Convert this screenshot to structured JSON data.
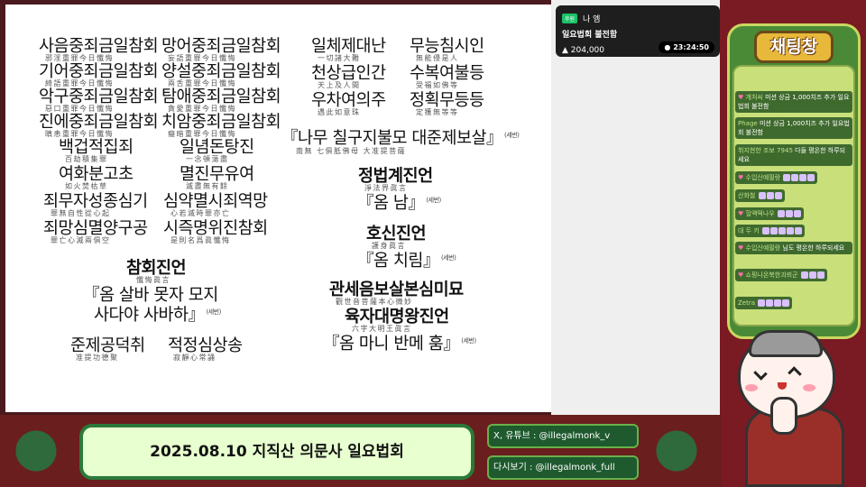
{
  "slide": {
    "left_column": [
      {
        "text": "사음중죄금일참회",
        "sub": "邪淫重罪今日懺悔"
      },
      {
        "text": "기어중죄금일참회",
        "sub": "綺語重罪今日懺悔"
      },
      {
        "text": "악구중죄금일참회",
        "sub": "惡口重罪今日懺悔"
      },
      {
        "text": "진에중죄금일참회",
        "sub": "瞋恚重罪今日懺悔"
      }
    ],
    "middle_column": [
      {
        "text": "망어중죄금일참회",
        "sub": "妄語重罪今日懺悔"
      },
      {
        "text": "양설중죄금일참회",
        "sub": "兩舌重罪今日懺悔"
      },
      {
        "text": "탐애중죄금일참회",
        "sub": "貪愛重罪今日懺悔"
      },
      {
        "text": "치암중죄금일참회",
        "sub": "癡暗重罪今日懺悔"
      }
    ],
    "verse_left": [
      {
        "text": "백겁적집죄",
        "sub": "百劫積集罪"
      },
      {
        "text": "일념돈탕진",
        "sub": "一念頓蕩盡"
      },
      {
        "text": "여화분고초",
        "sub": "如火焚枯草"
      },
      {
        "text": "멸진무유여",
        "sub": "滅盡無有餘"
      },
      {
        "text": "죄무자성종심기",
        "sub": "罪無自性從心起"
      },
      {
        "text": "심약멸시죄역망",
        "sub": "心若滅時罪亦亡"
      },
      {
        "text": "죄망심멸양구공",
        "sub": "罪亡心滅兩俱空"
      },
      {
        "text": "시즉명위진참회",
        "sub": "是則名爲眞懺悔"
      }
    ],
    "chamhoe_title": {
      "text": "참회진언",
      "sub": "懺悔眞言"
    },
    "chamhoe_mantra1": "『옴 살바 못자 모지",
    "chamhoe_mantra2": "사다야 사바하』",
    "tag": "(세번)",
    "junje_left": {
      "text": "준제공덕취",
      "sub": "准提功德聚"
    },
    "junje_right": {
      "text": "적정심상송",
      "sub": "寂靜心常誦"
    },
    "right_verse": [
      {
        "text": "일체제대난",
        "sub": "一切諸大難"
      },
      {
        "text": "무능침시인",
        "sub": "無能侵是人"
      },
      {
        "text": "천상급인간",
        "sub": "天上及人間"
      },
      {
        "text": "수복여불등",
        "sub": "受福如佛等"
      },
      {
        "text": "우차여의주",
        "sub": "遇此如意珠"
      },
      {
        "text": "정획무등등",
        "sub": "定獲無等等"
      }
    ],
    "namu_line": "『나무 칠구지불모 대준제보살』",
    "namu_sub": "南無 七俱胝佛母 大准提菩薩",
    "jeongbeop_title": {
      "text": "정법계진언",
      "sub": "淨法界眞言"
    },
    "jeongbeop_mantra": "『옴 남』",
    "hosin_title": {
      "text": "호신진언",
      "sub": "護身眞言"
    },
    "hosin_mantra": "『옴 치림』",
    "gwanse_title": {
      "text": "관세음보살본심미묘",
      "sub": "觀世音菩薩本心微妙"
    },
    "yukja_title": {
      "text": "육자대명왕진언",
      "sub": "六字大明王眞言"
    },
    "yukja_mantra": "『옴 마니 반메 훔』"
  },
  "notification": {
    "badge": "후원",
    "name": "나 엠",
    "message": "일요법회 불전함",
    "amount": "204,000",
    "timer": "23:24:50"
  },
  "chat": {
    "title": "채팅창",
    "messages": [
      {
        "nick": "개처씨",
        "text": "미션 상금 1,000치즈 추가 일요법회 불전함"
      },
      {
        "nick": "Phage",
        "text": "미션 상금 1,000치즈 추가 일요법회 불전함"
      },
      {
        "nick": "뷔지현한 조보 7945",
        "text": "다들 평온한 하루되세요"
      },
      {
        "nick": "수입산예필랑",
        "text": ""
      },
      {
        "nick": "산화철",
        "text": ""
      },
      {
        "nick": "헐액떡나우",
        "text": ""
      },
      {
        "nick": "대 두 키",
        "text": ""
      },
      {
        "nick": "수입산예필랑",
        "text": "님도 평온한 하루되세요"
      },
      {
        "nick": "쇼핑나온북한괴뢰군",
        "text": ""
      },
      {
        "nick": "Zetra",
        "text": ""
      }
    ]
  },
  "bottom": {
    "title": "2025.08.10 지직산 의문사 일요법회",
    "social_x": "X, 유튜브 : @illegalmonk_v",
    "social_replay": "다시보기 : @illegalmonk_full"
  }
}
